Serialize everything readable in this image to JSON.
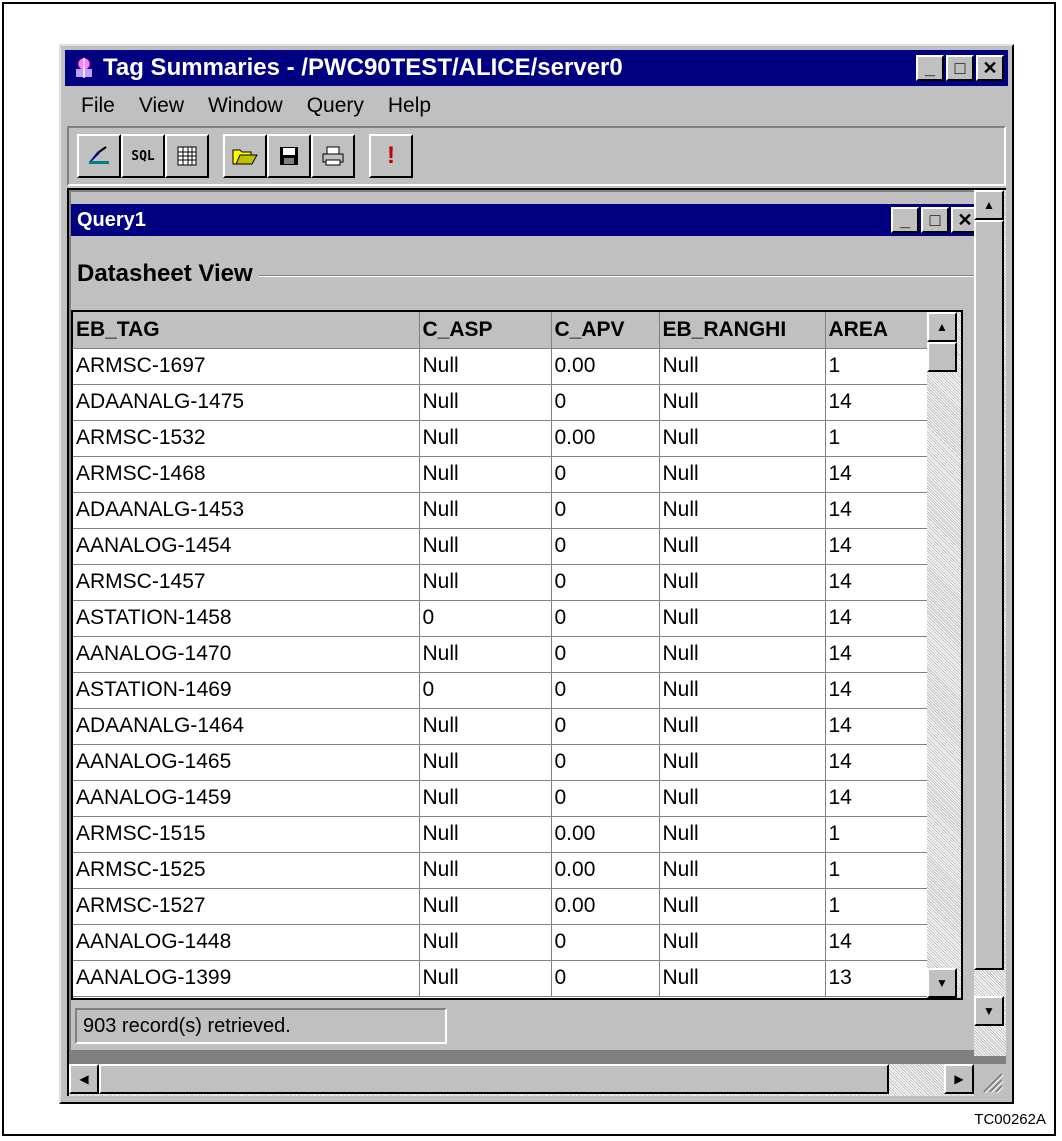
{
  "window": {
    "title": "Tag Summaries - /PWC90TEST/ALICE/server0",
    "min_glyph": "_",
    "max_glyph": "□",
    "close_glyph": "✕"
  },
  "menu": [
    "File",
    "View",
    "Window",
    "Query",
    "Help"
  ],
  "toolbar": {
    "sql_label": "SQL",
    "run_glyph": "!"
  },
  "child": {
    "title": "Query1",
    "section_label": "Datasheet View"
  },
  "table": {
    "columns": [
      "EB_TAG",
      "C_ASP",
      "C_APV",
      "EB_RANGHI",
      "AREA"
    ],
    "rows": [
      [
        "ARMSC-1697",
        "Null",
        "0.00",
        "Null",
        "1"
      ],
      [
        "ADAANALG-1475",
        "Null",
        "0",
        "Null",
        "14"
      ],
      [
        "ARMSC-1532",
        "Null",
        "0.00",
        "Null",
        "1"
      ],
      [
        "ARMSC-1468",
        "Null",
        "0",
        "Null",
        "14"
      ],
      [
        "ADAANALG-1453",
        "Null",
        "0",
        "Null",
        "14"
      ],
      [
        "AANALOG-1454",
        "Null",
        "0",
        "Null",
        "14"
      ],
      [
        "ARMSC-1457",
        "Null",
        "0",
        "Null",
        "14"
      ],
      [
        "ASTATION-1458",
        "0",
        "0",
        "Null",
        "14"
      ],
      [
        "AANALOG-1470",
        "Null",
        "0",
        "Null",
        "14"
      ],
      [
        "ASTATION-1469",
        "0",
        "0",
        "Null",
        "14"
      ],
      [
        "ADAANALG-1464",
        "Null",
        "0",
        "Null",
        "14"
      ],
      [
        "AANALOG-1465",
        "Null",
        "0",
        "Null",
        "14"
      ],
      [
        "AANALOG-1459",
        "Null",
        "0",
        "Null",
        "14"
      ],
      [
        "ARMSC-1515",
        "Null",
        "0.00",
        "Null",
        "1"
      ],
      [
        "ARMSC-1525",
        "Null",
        "0.00",
        "Null",
        "1"
      ],
      [
        "ARMSC-1527",
        "Null",
        "0.00",
        "Null",
        "1"
      ],
      [
        "AANALOG-1448",
        "Null",
        "0",
        "Null",
        "14"
      ],
      [
        "AANALOG-1399",
        "Null",
        "0",
        "Null",
        "13"
      ]
    ]
  },
  "status": "903 record(s) retrieved.",
  "figure_label": "TC00262A",
  "colors": {
    "titlebar": "#000080",
    "face": "#c0c0c0"
  }
}
